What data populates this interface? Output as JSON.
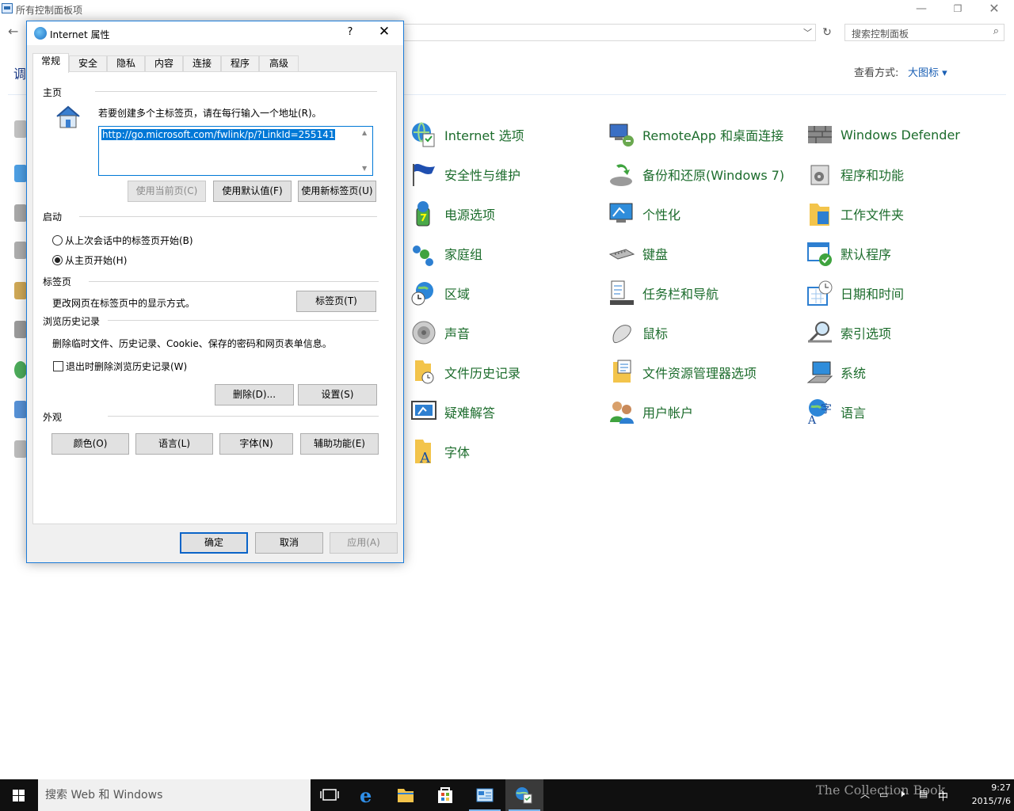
{
  "control_panel": {
    "title": "所有控制面板项",
    "window_controls": {
      "minimize": "—",
      "maximize": "❐",
      "close": "✕"
    },
    "back": "←",
    "search_placeholder": "搜索控制面板",
    "adjust_partial": "调",
    "view_by_label": "查看方式:",
    "view_by_value": "大图标 ▾",
    "items": [
      {
        "label": "Internet 选项",
        "icon": "internet-options-icon"
      },
      {
        "label": "RemoteApp 和桌面连接",
        "icon": "remoteapp-icon"
      },
      {
        "label": "Windows Defender",
        "icon": "defender-icon"
      },
      {
        "label": "安全性与维护",
        "icon": "security-flag-icon"
      },
      {
        "label": "备份和还原(Windows 7)",
        "icon": "backup-icon"
      },
      {
        "label": "程序和功能",
        "icon": "programs-icon"
      },
      {
        "label": "电源选项",
        "icon": "power-icon"
      },
      {
        "label": "个性化",
        "icon": "personalize-icon"
      },
      {
        "label": "工作文件夹",
        "icon": "work-folders-icon"
      },
      {
        "label": "家庭组",
        "icon": "homegroup-icon"
      },
      {
        "label": "键盘",
        "icon": "keyboard-icon"
      },
      {
        "label": "默认程序",
        "icon": "default-programs-icon"
      },
      {
        "label": "区域",
        "icon": "region-icon"
      },
      {
        "label": "任务栏和导航",
        "icon": "taskbar-icon"
      },
      {
        "label": "日期和时间",
        "icon": "datetime-icon"
      },
      {
        "label": "声音",
        "icon": "sound-icon"
      },
      {
        "label": "鼠标",
        "icon": "mouse-icon"
      },
      {
        "label": "索引选项",
        "icon": "indexing-icon"
      },
      {
        "label": "文件历史记录",
        "icon": "file-history-icon"
      },
      {
        "label": "文件资源管理器选项",
        "icon": "explorer-options-icon"
      },
      {
        "label": "系统",
        "icon": "system-icon"
      },
      {
        "label": "疑难解答",
        "icon": "troubleshoot-icon"
      },
      {
        "label": "用户帐户",
        "icon": "user-accounts-icon"
      },
      {
        "label": "语言",
        "icon": "language-icon"
      },
      {
        "label": "字体",
        "icon": "fonts-icon"
      }
    ]
  },
  "dialog": {
    "title": "Internet 属性",
    "help": "?",
    "close": "✕",
    "tabs": [
      "常规",
      "安全",
      "隐私",
      "内容",
      "连接",
      "程序",
      "高级"
    ],
    "active_tab": "常规",
    "homepage": {
      "group": "主页",
      "hint": "若要创建多个主标签页，请在每行输入一个地址(R)。",
      "url": "http://go.microsoft.com/fwlink/p/?LinkId=255141",
      "btn_current": "使用当前页(C)",
      "btn_default": "使用默认值(F)",
      "btn_newtab": "使用新标签页(U)"
    },
    "startup": {
      "group": "启动",
      "option_last": "从上次会话中的标签页开始(B)",
      "option_home": "从主页开始(H)",
      "selected": "从主页开始(H)"
    },
    "tabs_group": {
      "group": "标签页",
      "desc": "更改网页在标签页中的显示方式。",
      "btn": "标签页(T)"
    },
    "history": {
      "group": "浏览历史记录",
      "desc": "删除临时文件、历史记录、Cookie、保存的密码和网页表单信息。",
      "checkbox": "退出时删除浏览历史记录(W)",
      "checked": false,
      "btn_delete": "删除(D)...",
      "btn_settings": "设置(S)"
    },
    "appearance": {
      "group": "外观",
      "btn_colors": "颜色(O)",
      "btn_languages": "语言(L)",
      "btn_fonts": "字体(N)",
      "btn_accessibility": "辅助功能(E)"
    },
    "footer": {
      "ok": "确定",
      "cancel": "取消",
      "apply": "应用(A)"
    }
  },
  "taskbar": {
    "search_text": "搜索 Web 和 Windows",
    "ime": "中",
    "time": "9:27",
    "date": "2015/7/6",
    "watermark": "The Collection Book"
  },
  "colors": {
    "accent": "#0078d7",
    "link_green": "#1c6c2c",
    "taskbar": "#101010"
  }
}
